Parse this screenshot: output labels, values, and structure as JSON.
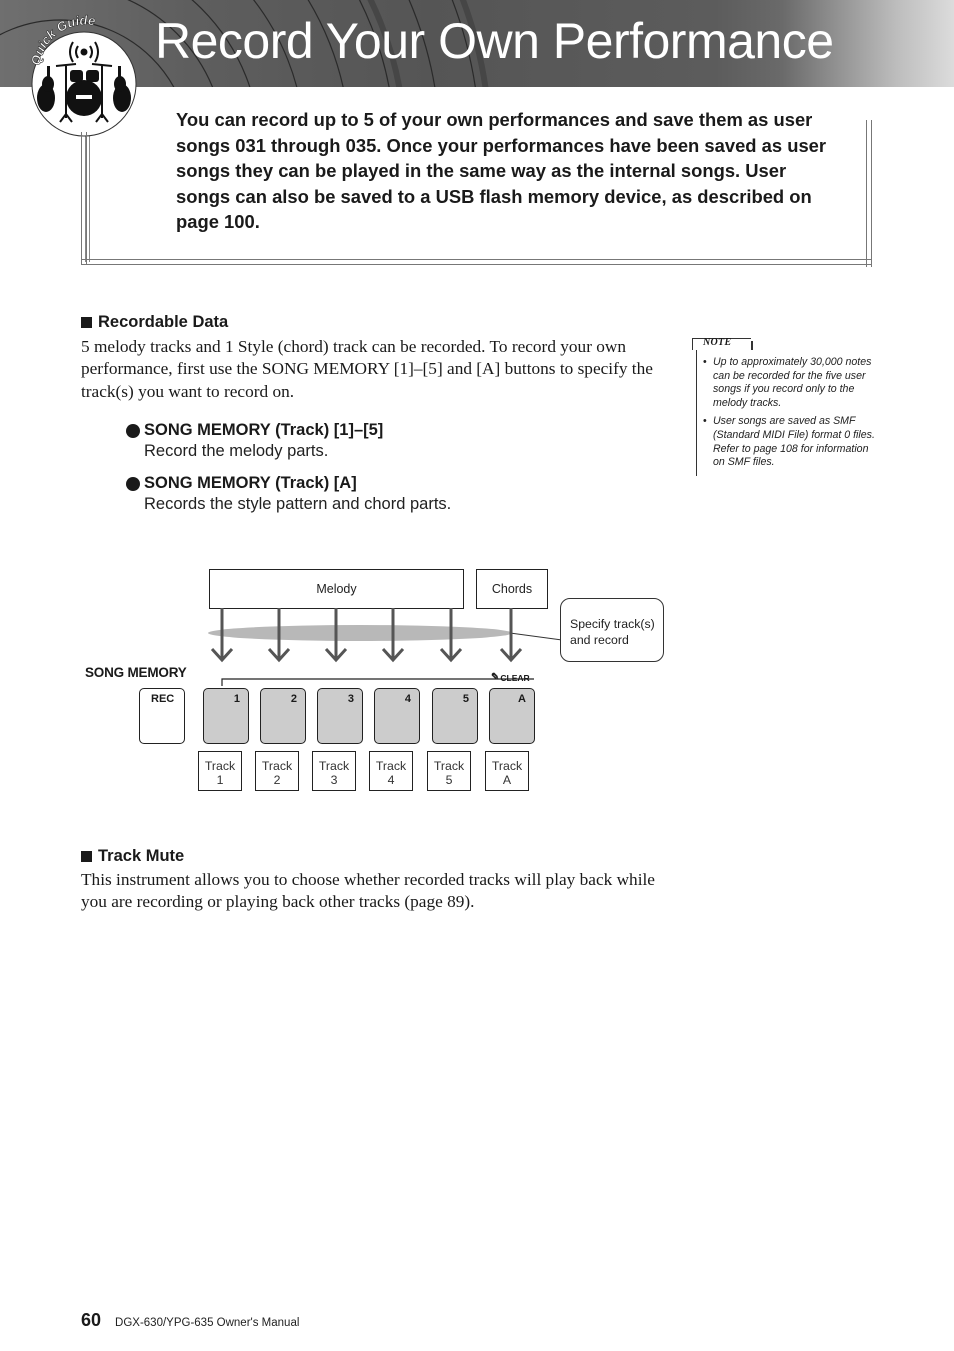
{
  "header": {
    "title": "Record Your Own Performance",
    "logo_text": "Quick Guide"
  },
  "intro": {
    "text": "You can record up to 5 of your own performances and save them as user songs 031 through 035. Once your performances have been saved as user songs they can be played in the same way as the internal songs. User songs can also be saved to a USB flash memory device, as described on page 100."
  },
  "recordable_data": {
    "heading": "Recordable Data",
    "body": "5 melody tracks and 1 Style (chord) track can be recorded. To record your own performance, first use the SONG MEMORY [1]–[5] and [A] buttons to specify the track(s) you want to record on.",
    "bullets": [
      {
        "title": "SONG MEMORY (Track) [1]–[5]",
        "desc": "Record the melody parts."
      },
      {
        "title": "SONG MEMORY (Track) [A]",
        "desc": "Records the style pattern and chord parts."
      }
    ]
  },
  "note": {
    "label": "NOTE",
    "items": [
      "Up to approximately 30,000 notes can be recorded for the five user songs if you record only to the melody tracks.",
      "User songs are saved as SMF (Standard MIDI File) format 0 files. Refer to page 108 for information on SMF files."
    ]
  },
  "diagram": {
    "melody_label": "Melody",
    "chords_label": "Chords",
    "callout": "Specify track(s) and record",
    "panel_label": "SONG MEMORY",
    "clear_label": "CLEAR",
    "rec_label": "REC",
    "buttons": [
      "1",
      "2",
      "3",
      "4",
      "5",
      "A"
    ],
    "tracks": [
      {
        "line1": "Track",
        "line2": "1"
      },
      {
        "line1": "Track",
        "line2": "2"
      },
      {
        "line1": "Track",
        "line2": "3"
      },
      {
        "line1": "Track",
        "line2": "4"
      },
      {
        "line1": "Track",
        "line2": "5"
      },
      {
        "line1": "Track",
        "line2": "A"
      }
    ]
  },
  "track_mute": {
    "heading": "Track Mute",
    "body": "This instrument allows you to choose whether recorded tracks will play back while you are recording or playing back other tracks (page 89)."
  },
  "footer": {
    "page_number": "60",
    "manual_title": "DGX-630/YPG-635  Owner's Manual"
  }
}
